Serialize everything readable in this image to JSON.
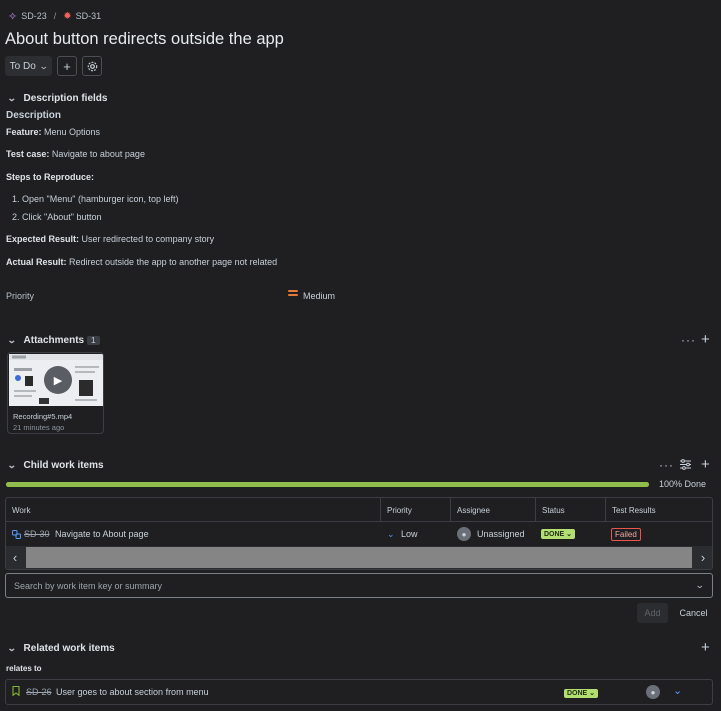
{
  "breadcrumb": {
    "parent_key": "SD-23",
    "separator": "/",
    "current_key": "SD-31"
  },
  "issue": {
    "title": "About button redirects outside the app",
    "status": "To Do"
  },
  "description_section": {
    "heading": "Description fields",
    "label": "Description",
    "feature_label": "Feature:",
    "feature_value": "Menu Options",
    "testcase_label": "Test case:",
    "testcase_value": "Navigate to about page",
    "steps_label": "Steps to Reproduce:",
    "steps": [
      "Open \"Menu\" (hamburger icon, top left)",
      "Click \"About\" button"
    ],
    "expected_label": "Expected Result:",
    "expected_value": "User redirected to company story",
    "actual_label": "Actual Result:",
    "actual_value": "Redirect outside the app to another page not related",
    "priority_label": "Priority",
    "priority_value": "Medium",
    "priority_color": "#e8783a"
  },
  "attachments": {
    "heading": "Attachments",
    "count": "1",
    "file_name": "Recording#5.mp4",
    "file_age": "21 minutes ago"
  },
  "child_items": {
    "heading": "Child work items",
    "progress_percent": 100,
    "progress_label": "100% Done",
    "progress_color": "#8fbc4c",
    "columns": [
      "Work",
      "Priority",
      "Assignee",
      "Status",
      "Test Results"
    ],
    "rows": [
      {
        "key": "SD-30",
        "summary": "Navigate to About page",
        "priority": "Low",
        "assignee": "Unassigned",
        "status": "DONE",
        "test_result": "Failed"
      }
    ],
    "search_placeholder": "Search by work item key or summary",
    "add_label": "Add",
    "cancel_label": "Cancel"
  },
  "related": {
    "heading": "Related work items",
    "relation_label": "relates to",
    "items": [
      {
        "key": "SD-26",
        "summary": "User goes to about section from menu",
        "status": "DONE"
      }
    ]
  }
}
